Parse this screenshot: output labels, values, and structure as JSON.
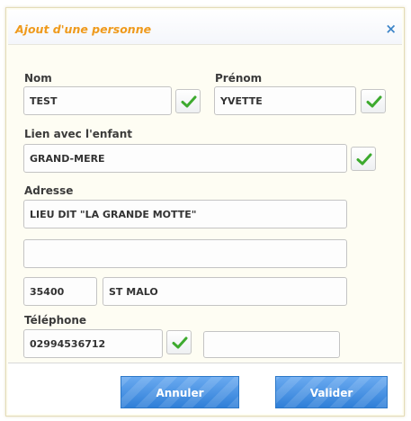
{
  "dialog": {
    "title": "Ajout d'une personne",
    "close_symbol": "×",
    "icon_close": "close-icon",
    "icon_check": "check-icon"
  },
  "fields": {
    "nom": {
      "label": "Nom",
      "value": "TEST"
    },
    "prenom": {
      "label": "Prénom",
      "value": "YVETTE"
    },
    "lien": {
      "label": "Lien avec l'enfant",
      "value": "GRAND-MERE"
    },
    "adresse": {
      "label": "Adresse",
      "line1": "LIEU DIT \"LA GRANDE MOTTE\"",
      "line2": "",
      "postal_code": "35400",
      "city": "ST MALO"
    },
    "telephone": {
      "label": "Téléphone",
      "value": "02994536712",
      "value2": ""
    }
  },
  "buttons": {
    "cancel": "Annuler",
    "validate": "Valider"
  },
  "colors": {
    "title": "#ef9a1c",
    "close": "#3f86c9",
    "check": "#3daa2e",
    "button": "#2f7fd8"
  }
}
